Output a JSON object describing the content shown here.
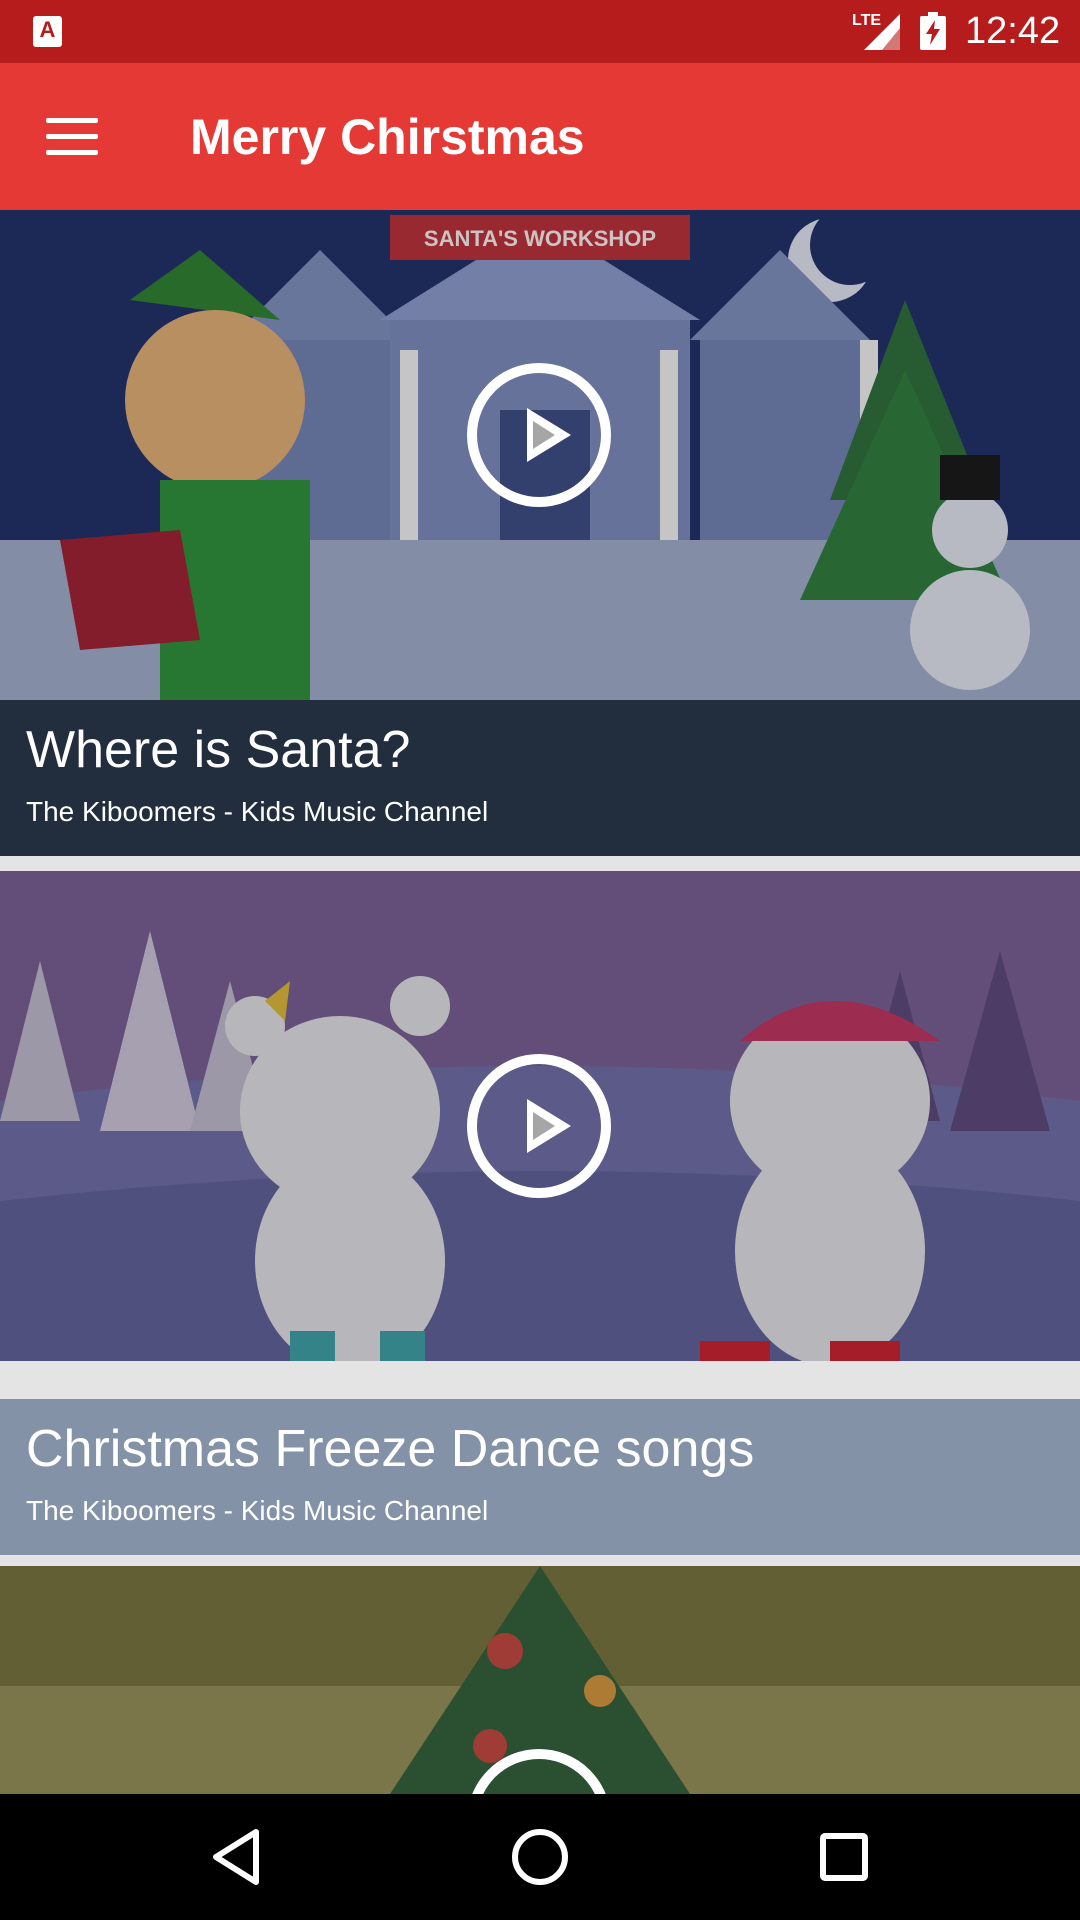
{
  "status_bar": {
    "time": "12:42",
    "network": "LTE",
    "app_icon_letter": "A"
  },
  "app_bar": {
    "title": "Merry Chirstmas",
    "menu_icon": "hamburger-menu-icon"
  },
  "videos": [
    {
      "title": "Where is Santa?",
      "channel": "The Kiboomers - Kids Music Channel",
      "sign_text": "SANTA'S WORKSHOP",
      "caption_color": "#222d3d"
    },
    {
      "title": "Christmas Freeze Dance songs",
      "channel": "The Kiboomers - Kids Music Channel",
      "caption_color": "#8392a7"
    },
    {
      "title": "",
      "channel": "",
      "caption_color": "#6e6a3a"
    }
  ],
  "nav_bar": {
    "back_icon": "back-triangle-icon",
    "home_icon": "home-circle-icon",
    "recents_icon": "recents-square-icon"
  },
  "colors": {
    "status_bar": "#b71c1c",
    "app_bar": "#e53935",
    "nav_bar": "#000000"
  }
}
